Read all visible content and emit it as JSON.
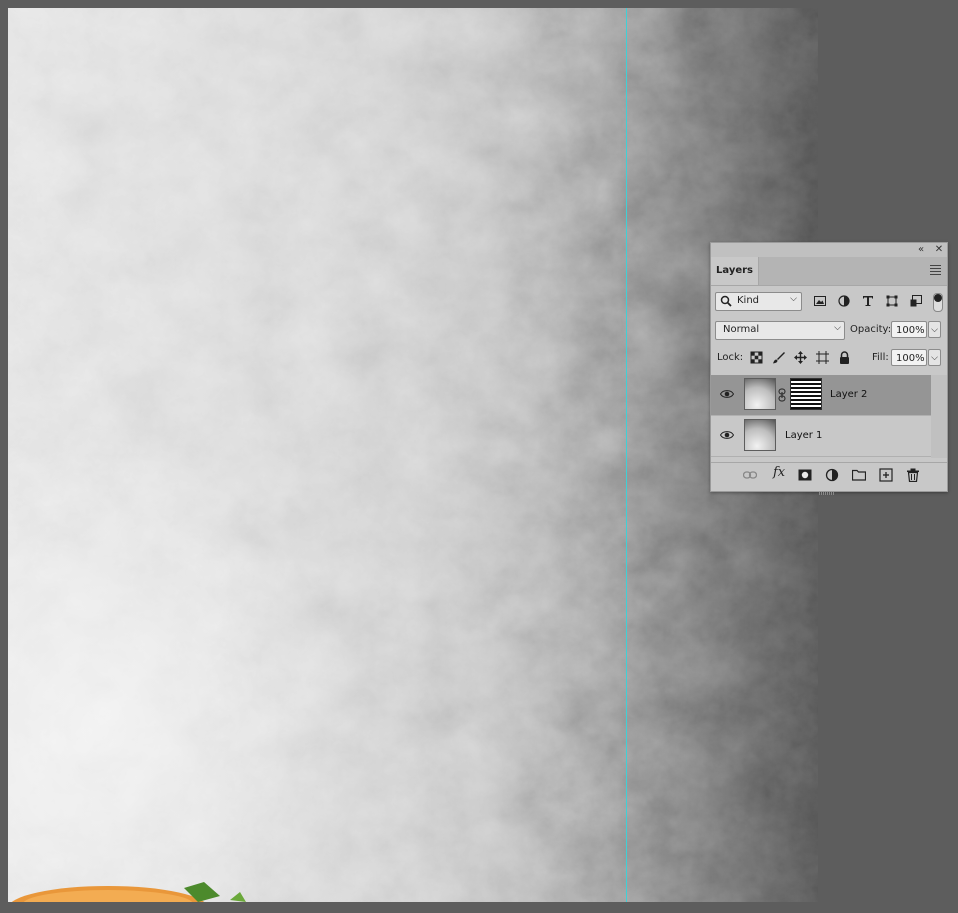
{
  "panel": {
    "tab_label": "Layers",
    "filter": {
      "kind_value": "Kind",
      "icons": [
        "image-filter-icon",
        "adjustment-filter-icon",
        "type-filter-icon",
        "shape-filter-icon",
        "smart-object-filter-icon"
      ]
    },
    "blend_mode": "Normal",
    "opacity_label": "Opacity:",
    "opacity_value": "100%",
    "lock_label": "Lock:",
    "lock_icons": [
      "lock-transparent-pixels-icon",
      "lock-image-pixels-icon",
      "lock-position-icon",
      "lock-artboard-icon",
      "lock-all-icon"
    ],
    "fill_label": "Fill:",
    "fill_value": "100%",
    "layers": [
      {
        "name": "Layer 2",
        "selected": true,
        "visible": true,
        "has_mask": true
      },
      {
        "name": "Layer 1",
        "selected": false,
        "visible": true,
        "has_mask": false
      }
    ],
    "bottom_icons": [
      "link-layers-icon",
      "fx-icon",
      "add-mask-icon",
      "adjustment-layer-icon",
      "new-group-icon",
      "new-layer-icon",
      "delete-layer-icon"
    ],
    "fx_text": "fx"
  },
  "colors": {
    "guide": "#3fd0d6",
    "workspace": "#5d5d5d",
    "panel_bg": "#c8c8c8",
    "selected_row": "#959595"
  }
}
